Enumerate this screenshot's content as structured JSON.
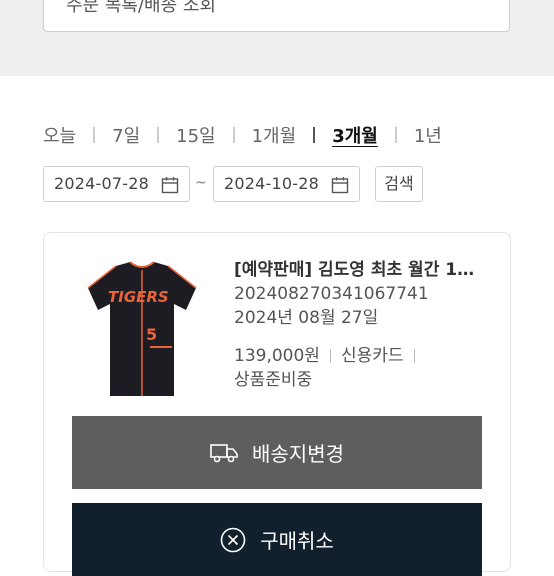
{
  "filter": {
    "label": "주문 목록/배송 조회"
  },
  "period": {
    "options": [
      "오늘",
      "7일",
      "15일",
      "1개월",
      "3개월",
      "1년"
    ],
    "selected": "3개월"
  },
  "date_range": {
    "start": "2024-07-28",
    "separator": "~",
    "end": "2024-10-28"
  },
  "search_button": "검색",
  "order": {
    "title": "[예약판매] 김도영 최초 월간 1…",
    "order_number": "20240827034106774​1",
    "order_date": "2024년 08월 27일",
    "price": "139,000원",
    "payment": "신용카드",
    "status": "상품준비중",
    "jersey_text": "TIGERS",
    "jersey_number": "5"
  },
  "buttons": {
    "change_address": "배송지변경",
    "cancel": "구매취소"
  },
  "colors": {
    "dark_button": "#12202e",
    "gray_button": "#5e5e5e",
    "jersey_accent": "#e8643a"
  }
}
